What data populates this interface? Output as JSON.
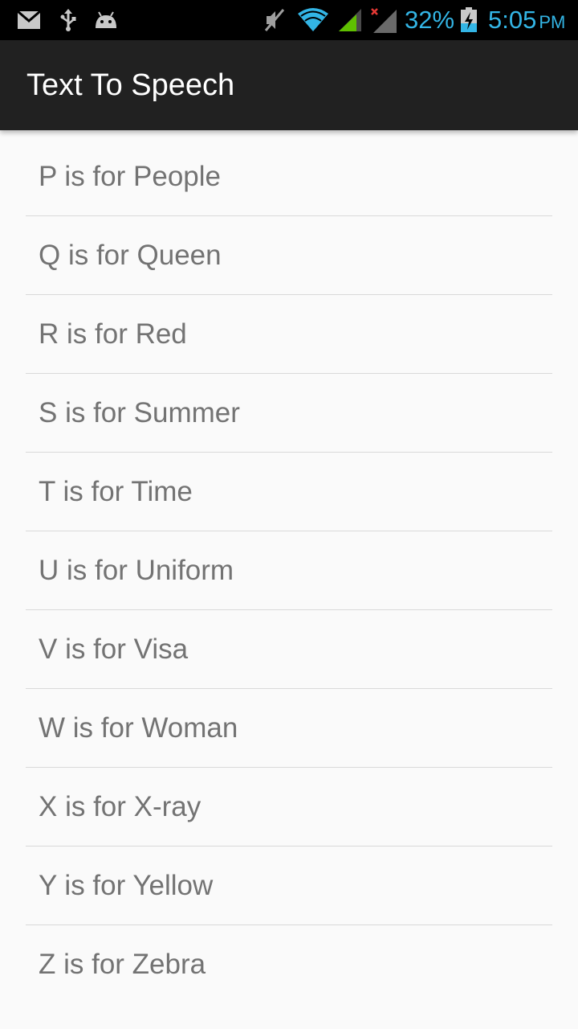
{
  "status_bar": {
    "icons_left": [
      "gmail-icon",
      "usb-icon",
      "android-debug-icon"
    ],
    "icons_right": [
      "mute-icon",
      "wifi-icon",
      "signal-sim1-icon",
      "signal-sim2-no-service-icon",
      "battery-charging-icon"
    ],
    "battery_percent": "32%",
    "time": "5:05",
    "ampm": "PM",
    "accent_color": "#33b5e5"
  },
  "action_bar": {
    "title": "Text To Speech",
    "background": "#212121"
  },
  "list": {
    "items": [
      {
        "label": "P is for People"
      },
      {
        "label": "Q is for Queen"
      },
      {
        "label": "R is for Red"
      },
      {
        "label": "S is for Summer"
      },
      {
        "label": "T is for Time"
      },
      {
        "label": "U is for Uniform"
      },
      {
        "label": "V is for Visa"
      },
      {
        "label": "W is for Woman"
      },
      {
        "label": "X is for X-ray"
      },
      {
        "label": "Y is for Yellow"
      },
      {
        "label": "Z is for Zebra"
      }
    ]
  }
}
